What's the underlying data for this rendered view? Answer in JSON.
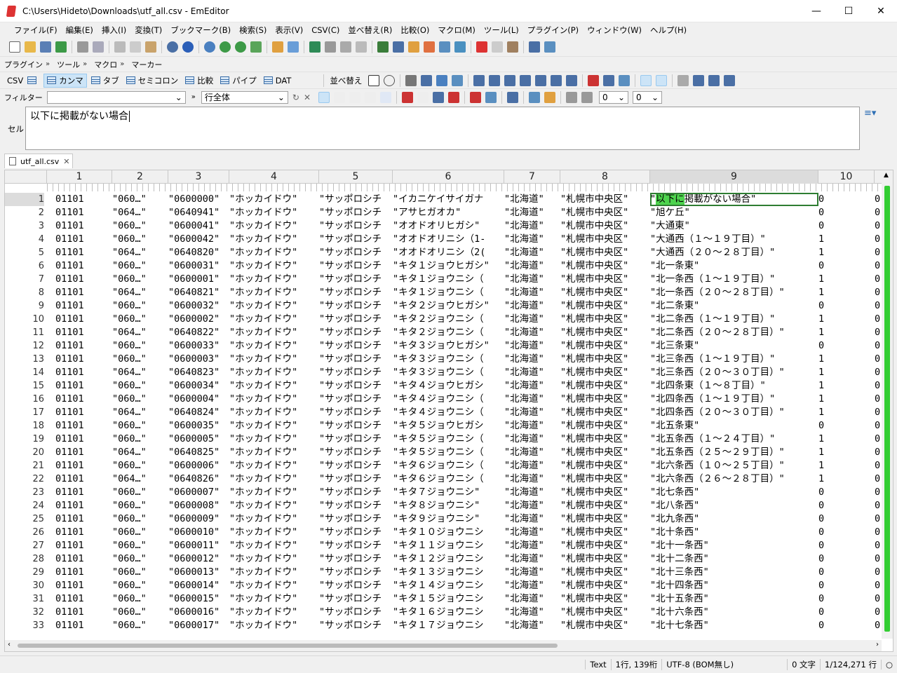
{
  "window": {
    "title": "C:\\Users\\Hideto\\Downloads\\utf_all.csv - EmEditor"
  },
  "menu": [
    "ファイル(F)",
    "編集(E)",
    "挿入(I)",
    "変換(T)",
    "ブックマーク(B)",
    "検索(S)",
    "表示(V)",
    "CSV(C)",
    "並べ替え(R)",
    "比較(O)",
    "マクロ(M)",
    "ツール(L)",
    "プラグイン(P)",
    "ウィンドウ(W)",
    "ヘルプ(H)"
  ],
  "toolbar2": {
    "plugins": "プラグイン",
    "tools": "ツール",
    "macros": "マクロ",
    "markers": "マーカー"
  },
  "csvbar": {
    "csv": "CSV",
    "comma": "カンマ",
    "tab": "タブ",
    "semicolon": "セミコロン",
    "compare": "比較",
    "pipe": "パイプ",
    "dat": "DAT",
    "sort": "並べ替え"
  },
  "filterbar": {
    "label": "フィルター",
    "filter_value": "",
    "scope": "行全体",
    "num1": "0",
    "num2": "0"
  },
  "cell": {
    "label": "セル",
    "value": "以下に掲載がない場合"
  },
  "tab": {
    "label": "utf_all.csv"
  },
  "columns": [
    "1",
    "2",
    "3",
    "4",
    "5",
    "6",
    "7",
    "8",
    "9",
    "10"
  ],
  "rows": [
    [
      "1",
      "01101",
      "\"060…\"",
      "\"0600000\"",
      "\"ホッカイドウ\"",
      "\"サッポロシチ",
      "\"イカニケイサイガナ",
      "\"北海道\"",
      "\"札幌市中央区\"",
      "\"以下に掲載がない場合\"",
      "0",
      "0"
    ],
    [
      "2",
      "01101",
      "\"064…\"",
      "\"0640941\"",
      "\"ホッカイドウ\"",
      "\"サッポロシチ",
      "\"アサヒガオカ\"",
      "\"北海道\"",
      "\"札幌市中央区\"",
      "\"旭ケ丘\"",
      "0",
      "0"
    ],
    [
      "3",
      "01101",
      "\"060…\"",
      "\"0600041\"",
      "\"ホッカイドウ\"",
      "\"サッポロシチ",
      "\"オオドオリヒガシ\"",
      "\"北海道\"",
      "\"札幌市中央区\"",
      "\"大通東\"",
      "0",
      "0"
    ],
    [
      "4",
      "01101",
      "\"060…\"",
      "\"0600042\"",
      "\"ホッカイドウ\"",
      "\"サッポロシチ",
      "\"オオドオリニシ（1-",
      "\"北海道\"",
      "\"札幌市中央区\"",
      "\"大通西（１〜１９丁目）\"",
      "1",
      "0"
    ],
    [
      "5",
      "01101",
      "\"064…\"",
      "\"0640820\"",
      "\"ホッカイドウ\"",
      "\"サッポロシチ",
      "\"オオドオリニシ（2(",
      "\"北海道\"",
      "\"札幌市中央区\"",
      "\"大通西（２０〜２８丁目）\"",
      "1",
      "0"
    ],
    [
      "6",
      "01101",
      "\"060…\"",
      "\"0600031\"",
      "\"ホッカイドウ\"",
      "\"サッポロシチ",
      "\"キタ１ジョウヒガシ\"",
      "\"北海道\"",
      "\"札幌市中央区\"",
      "\"北一条東\"",
      "0",
      "0"
    ],
    [
      "7",
      "01101",
      "\"060…\"",
      "\"0600001\"",
      "\"ホッカイドウ\"",
      "\"サッポロシチ",
      "\"キタ１ジョウニシ（",
      "\"北海道\"",
      "\"札幌市中央区\"",
      "\"北一条西（１〜１９丁目）\"",
      "1",
      "0"
    ],
    [
      "8",
      "01101",
      "\"064…\"",
      "\"0640821\"",
      "\"ホッカイドウ\"",
      "\"サッポロシチ",
      "\"キタ１ジョウニシ（",
      "\"北海道\"",
      "\"札幌市中央区\"",
      "\"北一条西（２０〜２８丁目）\"",
      "1",
      "0"
    ],
    [
      "9",
      "01101",
      "\"060…\"",
      "\"0600032\"",
      "\"ホッカイドウ\"",
      "\"サッポロシチ",
      "\"キタ２ジョウヒガシ\"",
      "\"北海道\"",
      "\"札幌市中央区\"",
      "\"北二条東\"",
      "0",
      "0"
    ],
    [
      "10",
      "01101",
      "\"060…\"",
      "\"0600002\"",
      "\"ホッカイドウ\"",
      "\"サッポロシチ",
      "\"キタ２ジョウニシ（",
      "\"北海道\"",
      "\"札幌市中央区\"",
      "\"北二条西（１〜１９丁目）\"",
      "1",
      "0"
    ],
    [
      "11",
      "01101",
      "\"064…\"",
      "\"0640822\"",
      "\"ホッカイドウ\"",
      "\"サッポロシチ",
      "\"キタ２ジョウニシ（",
      "\"北海道\"",
      "\"札幌市中央区\"",
      "\"北二条西（２０〜２８丁目）\"",
      "1",
      "0"
    ],
    [
      "12",
      "01101",
      "\"060…\"",
      "\"0600033\"",
      "\"ホッカイドウ\"",
      "\"サッポロシチ",
      "\"キタ３ジョウヒガシ\"",
      "\"北海道\"",
      "\"札幌市中央区\"",
      "\"北三条東\"",
      "0",
      "0"
    ],
    [
      "13",
      "01101",
      "\"060…\"",
      "\"0600003\"",
      "\"ホッカイドウ\"",
      "\"サッポロシチ",
      "\"キタ３ジョウニシ（",
      "\"北海道\"",
      "\"札幌市中央区\"",
      "\"北三条西（１〜１９丁目）\"",
      "1",
      "0"
    ],
    [
      "14",
      "01101",
      "\"064…\"",
      "\"0640823\"",
      "\"ホッカイドウ\"",
      "\"サッポロシチ",
      "\"キタ３ジョウニシ（",
      "\"北海道\"",
      "\"札幌市中央区\"",
      "\"北三条西（２０〜３０丁目）\"",
      "1",
      "0"
    ],
    [
      "15",
      "01101",
      "\"060…\"",
      "\"0600034\"",
      "\"ホッカイドウ\"",
      "\"サッポロシチ",
      "\"キタ４ジョウヒガシ",
      "\"北海道\"",
      "\"札幌市中央区\"",
      "\"北四条東（１〜８丁目）\"",
      "1",
      "0"
    ],
    [
      "16",
      "01101",
      "\"060…\"",
      "\"0600004\"",
      "\"ホッカイドウ\"",
      "\"サッポロシチ",
      "\"キタ４ジョウニシ（",
      "\"北海道\"",
      "\"札幌市中央区\"",
      "\"北四条西（１〜１９丁目）\"",
      "1",
      "0"
    ],
    [
      "17",
      "01101",
      "\"064…\"",
      "\"0640824\"",
      "\"ホッカイドウ\"",
      "\"サッポロシチ",
      "\"キタ４ジョウニシ（",
      "\"北海道\"",
      "\"札幌市中央区\"",
      "\"北四条西（２０〜３０丁目）\"",
      "1",
      "0"
    ],
    [
      "18",
      "01101",
      "\"060…\"",
      "\"0600035\"",
      "\"ホッカイドウ\"",
      "\"サッポロシチ",
      "\"キタ５ジョウヒガシ",
      "\"北海道\"",
      "\"札幌市中央区\"",
      "\"北五条東\"",
      "0",
      "0"
    ],
    [
      "19",
      "01101",
      "\"060…\"",
      "\"0600005\"",
      "\"ホッカイドウ\"",
      "\"サッポロシチ",
      "\"キタ５ジョウニシ（",
      "\"北海道\"",
      "\"札幌市中央区\"",
      "\"北五条西（１〜２４丁目）\"",
      "1",
      "0"
    ],
    [
      "20",
      "01101",
      "\"064…\"",
      "\"0640825\"",
      "\"ホッカイドウ\"",
      "\"サッポロシチ",
      "\"キタ５ジョウニシ（",
      "\"北海道\"",
      "\"札幌市中央区\"",
      "\"北五条西（２５〜２９丁目）\"",
      "1",
      "0"
    ],
    [
      "21",
      "01101",
      "\"060…\"",
      "\"0600006\"",
      "\"ホッカイドウ\"",
      "\"サッポロシチ",
      "\"キタ６ジョウニシ（",
      "\"北海道\"",
      "\"札幌市中央区\"",
      "\"北六条西（１０〜２５丁目）\"",
      "1",
      "0"
    ],
    [
      "22",
      "01101",
      "\"064…\"",
      "\"0640826\"",
      "\"ホッカイドウ\"",
      "\"サッポロシチ",
      "\"キタ６ジョウニシ（",
      "\"北海道\"",
      "\"札幌市中央区\"",
      "\"北六条西（２６〜２８丁目）\"",
      "1",
      "0"
    ],
    [
      "23",
      "01101",
      "\"060…\"",
      "\"0600007\"",
      "\"ホッカイドウ\"",
      "\"サッポロシチ",
      "\"キタ７ジョウニシ\"",
      "\"北海道\"",
      "\"札幌市中央区\"",
      "\"北七条西\"",
      "0",
      "0"
    ],
    [
      "24",
      "01101",
      "\"060…\"",
      "\"0600008\"",
      "\"ホッカイドウ\"",
      "\"サッポロシチ",
      "\"キタ８ジョウニシ\"",
      "\"北海道\"",
      "\"札幌市中央区\"",
      "\"北八条西\"",
      "0",
      "0"
    ],
    [
      "25",
      "01101",
      "\"060…\"",
      "\"0600009\"",
      "\"ホッカイドウ\"",
      "\"サッポロシチ",
      "\"キタ９ジョウニシ\"",
      "\"北海道\"",
      "\"札幌市中央区\"",
      "\"北九条西\"",
      "0",
      "0"
    ],
    [
      "26",
      "01101",
      "\"060…\"",
      "\"0600010\"",
      "\"ホッカイドウ\"",
      "\"サッポロシチ",
      "\"キタ１０ジョウニシ",
      "\"北海道\"",
      "\"札幌市中央区\"",
      "\"北十条西\"",
      "0",
      "0"
    ],
    [
      "27",
      "01101",
      "\"060…\"",
      "\"0600011\"",
      "\"ホッカイドウ\"",
      "\"サッポロシチ",
      "\"キタ１１ジョウニシ",
      "\"北海道\"",
      "\"札幌市中央区\"",
      "\"北十一条西\"",
      "0",
      "0"
    ],
    [
      "28",
      "01101",
      "\"060…\"",
      "\"0600012\"",
      "\"ホッカイドウ\"",
      "\"サッポロシチ",
      "\"キタ１２ジョウニシ",
      "\"北海道\"",
      "\"札幌市中央区\"",
      "\"北十二条西\"",
      "0",
      "0"
    ],
    [
      "29",
      "01101",
      "\"060…\"",
      "\"0600013\"",
      "\"ホッカイドウ\"",
      "\"サッポロシチ",
      "\"キタ１３ジョウニシ",
      "\"北海道\"",
      "\"札幌市中央区\"",
      "\"北十三条西\"",
      "0",
      "0"
    ],
    [
      "30",
      "01101",
      "\"060…\"",
      "\"0600014\"",
      "\"ホッカイドウ\"",
      "\"サッポロシチ",
      "\"キタ１４ジョウニシ",
      "\"北海道\"",
      "\"札幌市中央区\"",
      "\"北十四条西\"",
      "0",
      "0"
    ],
    [
      "31",
      "01101",
      "\"060…\"",
      "\"0600015\"",
      "\"ホッカイドウ\"",
      "\"サッポロシチ",
      "\"キタ１５ジョウニシ",
      "\"北海道\"",
      "\"札幌市中央区\"",
      "\"北十五条西\"",
      "0",
      "0"
    ],
    [
      "32",
      "01101",
      "\"060…\"",
      "\"0600016\"",
      "\"ホッカイドウ\"",
      "\"サッポロシチ",
      "\"キタ１６ジョウニシ",
      "\"北海道\"",
      "\"札幌市中央区\"",
      "\"北十六条西\"",
      "0",
      "0"
    ],
    [
      "33",
      "01101",
      "\"060…\"",
      "\"0600017\"",
      "\"ホッカイドウ\"",
      "\"サッポロシチ",
      "\"キタ１７ジョウニシ",
      "\"北海道\"",
      "\"札幌市中央区\"",
      "\"北十七条西\"",
      "0",
      "0"
    ]
  ],
  "status": {
    "mode": "Text",
    "position": "1行, 139桁",
    "encoding": "UTF-8 (BOM無し)",
    "chars": "0 文字",
    "lines": "1/124,271 行"
  },
  "colors": {
    "accent": "#32cd32",
    "cell_highlight": "#4dd34d",
    "selection_border": "#2e7d32"
  }
}
